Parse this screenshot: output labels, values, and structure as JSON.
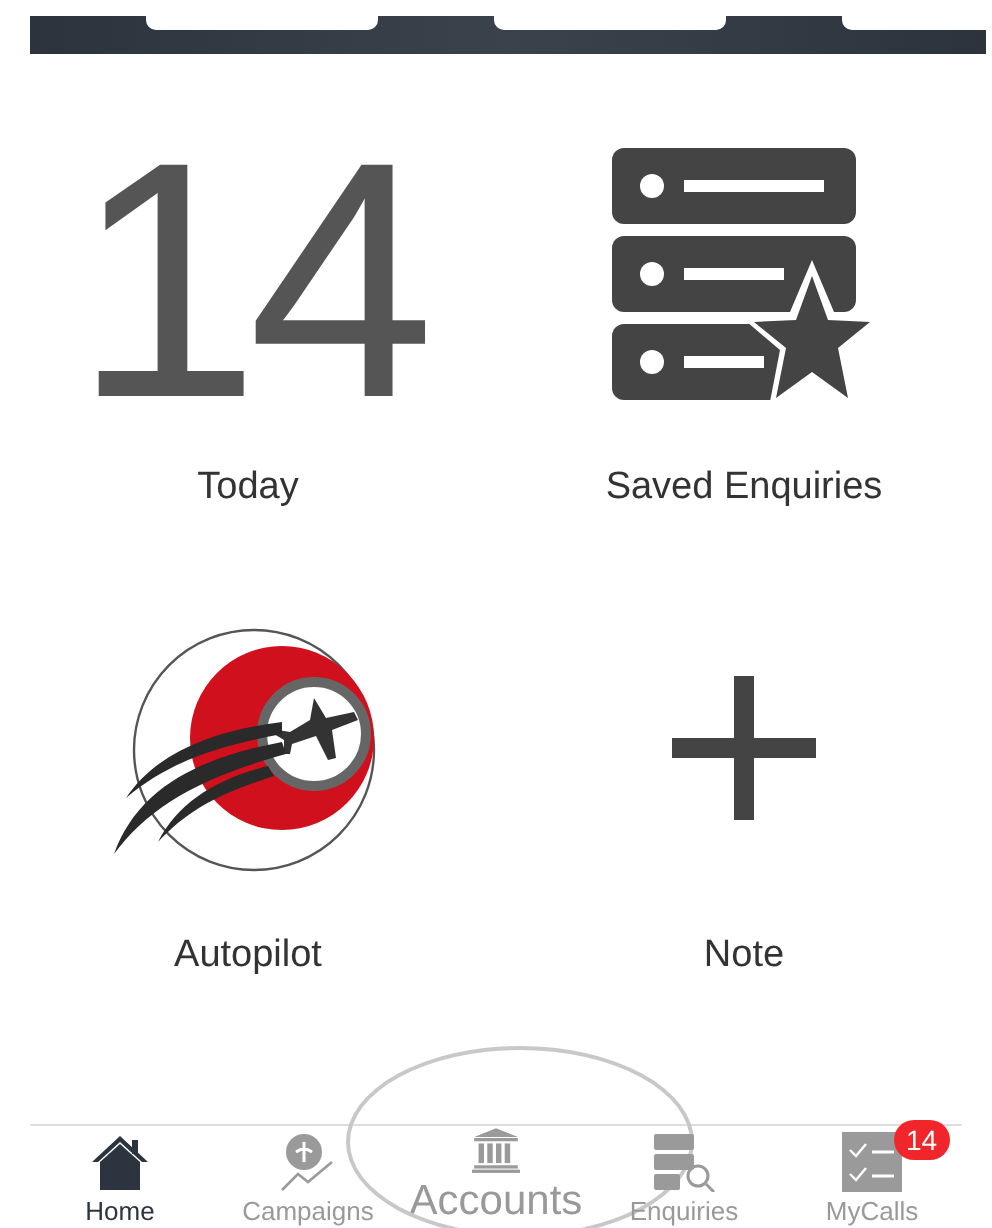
{
  "top_bar": {
    "buttons": [
      {
        "kind": "button"
      },
      {
        "kind": "button"
      },
      {
        "kind": "button"
      }
    ]
  },
  "tiles": [
    {
      "kind": "count",
      "value": "14",
      "label": "Today"
    },
    {
      "kind": "saved",
      "label": "Saved Enquiries"
    },
    {
      "kind": "logo",
      "label": "Autopilot"
    },
    {
      "kind": "plus",
      "label": "Note"
    }
  ],
  "tab_bar": {
    "tabs": [
      {
        "kind": "home",
        "label": "Home",
        "selected": true,
        "highlighted": false
      },
      {
        "kind": "campaigns",
        "label": "Campaigns",
        "selected": false,
        "highlighted": false
      },
      {
        "kind": "accounts",
        "label": "Accounts",
        "selected": false,
        "highlighted": true
      },
      {
        "kind": "enquiries",
        "label": "Enquiries",
        "selected": false,
        "highlighted": false
      },
      {
        "kind": "calls",
        "label": "MyCalls",
        "selected": false,
        "highlighted": false,
        "badge": "14"
      }
    ]
  }
}
